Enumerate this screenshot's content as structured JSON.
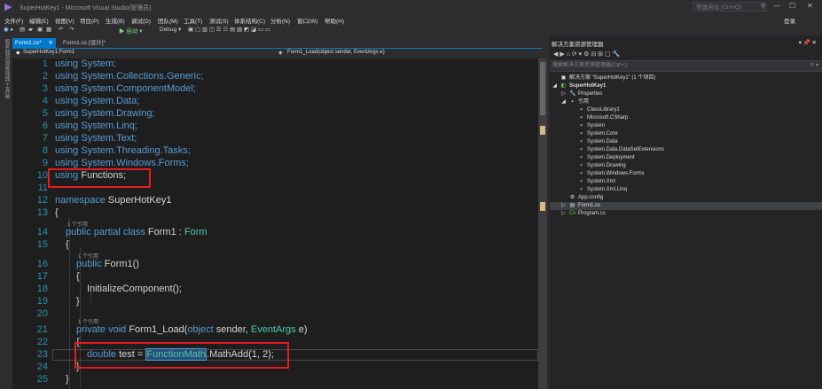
{
  "window": {
    "title": "SuperHotKey1 - Microsoft Visual Studio(管理员)",
    "quick_launch_placeholder": "快速启动 (Ctrl+Q)",
    "logo_icon": "visual-studio-icon",
    "login": "登录",
    "controls": {
      "minimize": "—",
      "maximize": "☐",
      "close": "✕"
    }
  },
  "menu": [
    "文件(F)",
    "编辑(E)",
    "视图(V)",
    "项目(P)",
    "生成(B)",
    "调试(D)",
    "团队(M)",
    "工具(T)",
    "测试(S)",
    "体系结构(C)",
    "分析(N)",
    "窗口(W)",
    "帮助(H)"
  ],
  "toolbar": {
    "start": "▶ 启动 ▾",
    "config": "Debug ▾"
  },
  "left_strip": {
    "label": "服务器资源管理器 工具箱"
  },
  "tabs": [
    {
      "label": "Form1.cs*",
      "close": "✕",
      "active": true
    },
    {
      "label": "Form1.cs [设计]*",
      "active": false
    }
  ],
  "navbar": {
    "class_scope": "SuperHotKey1.Form1",
    "member_scope": "Form1_Load(object sender, EventArgs e)"
  },
  "editor": {
    "line_numbers": [
      "1",
      "2",
      "3",
      "4",
      "5",
      "6",
      "7",
      "8",
      "9",
      "10",
      "11",
      "12",
      "13",
      "14",
      "15",
      "16",
      "17",
      "18",
      "19",
      "20",
      "21",
      "22",
      "23",
      "24",
      "25"
    ],
    "lines": {
      "l1": "using System;",
      "l2": "using System.Collections.Generic;",
      "l3": "using System.ComponentModel;",
      "l4": "using System.Data;",
      "l5": "using System.Drawing;",
      "l6": "using System.Linq;",
      "l7": "using System.Text;",
      "l8": "using System.Threading.Tasks;",
      "l9": "using System.Windows.Forms;",
      "l10_kw": "using",
      "l10_rest": " Functions;",
      "l12_kw": "namespace",
      "l12_rest": " SuperHotKey1",
      "open_brace": "{",
      "close_brace": "}",
      "l14_kw": "public partial class",
      "l14_name": " Form1 : ",
      "l14_base": "Form",
      "l16_kw": "public",
      "l16_rest": " Form1()",
      "l18": "InitializeComponent();",
      "l21_kw": "private void",
      "l21_mid": " Form1_Load(",
      "l21_obj": "object",
      "l21_mid2": " sender, ",
      "l21_type": "EventArgs",
      "l21_end": " e)",
      "l23_kw": "double",
      "l23_mid": " test = ",
      "l23_hl": "FunctionMath",
      "l23_end": ".MathAdd(1, 2);"
    },
    "codelens": "1 个引用"
  },
  "solution_explorer": {
    "title": "解决方案资源管理器",
    "pin_icon": "▾ 📌 ✕",
    "toolbar_icons": "◀ ▶ ⌂ ⟳ ▾ ⚙ ⊟ ⊞ ▢ 🔧",
    "search_placeholder": "搜索解决方案资源管理器(Ctrl+;)",
    "items": [
      {
        "label": "解决方案 “SuperHotKey1” (1 个项目)",
        "icon": "solution-icon",
        "glyph": "▣",
        "exp": ""
      },
      {
        "label": "SuperHotKey1",
        "icon": "csharp-project-icon",
        "glyph": "◧",
        "exp": "◢"
      },
      {
        "label": "Properties",
        "icon": "wrench-icon",
        "glyph": "🔧",
        "exp": "▷"
      },
      {
        "label": "引用",
        "icon": "references-icon",
        "glyph": "▪",
        "exp": "◢"
      },
      {
        "label": "ClassLibrary1",
        "icon": "assembly-icon",
        "glyph": "▪",
        "exp": ""
      },
      {
        "label": "Microsoft.CSharp",
        "icon": "assembly-icon",
        "glyph": "▪",
        "exp": ""
      },
      {
        "label": "System",
        "icon": "assembly-icon",
        "glyph": "▪",
        "exp": ""
      },
      {
        "label": "System.Core",
        "icon": "assembly-icon",
        "glyph": "▪",
        "exp": ""
      },
      {
        "label": "System.Data",
        "icon": "assembly-icon",
        "glyph": "▪",
        "exp": ""
      },
      {
        "label": "System.Data.DataSetExtensions",
        "icon": "assembly-icon",
        "glyph": "▪",
        "exp": ""
      },
      {
        "label": "System.Deployment",
        "icon": "assembly-icon",
        "glyph": "▪",
        "exp": ""
      },
      {
        "label": "System.Drawing",
        "icon": "assembly-icon",
        "glyph": "▪",
        "exp": ""
      },
      {
        "label": "System.Windows.Forms",
        "icon": "assembly-icon",
        "glyph": "▪",
        "exp": ""
      },
      {
        "label": "System.Xml",
        "icon": "assembly-icon",
        "glyph": "▪",
        "exp": ""
      },
      {
        "label": "System.Xml.Linq",
        "icon": "assembly-icon",
        "glyph": "▪",
        "exp": ""
      },
      {
        "label": "App.config",
        "icon": "config-file-icon",
        "glyph": "⚙",
        "exp": ""
      },
      {
        "label": "Form1.cs",
        "icon": "form-file-icon",
        "glyph": "▤",
        "exp": "▷"
      },
      {
        "label": "Program.cs",
        "icon": "csharp-file-icon",
        "glyph": "C#",
        "exp": "▷"
      }
    ]
  },
  "colors": {
    "accent": "#007acc",
    "editor_bg": "#1e1e1e",
    "keyword": "#569cd6",
    "type": "#4ec9b0",
    "line_number": "#2b91af",
    "annotation_box": "#e51c23"
  }
}
